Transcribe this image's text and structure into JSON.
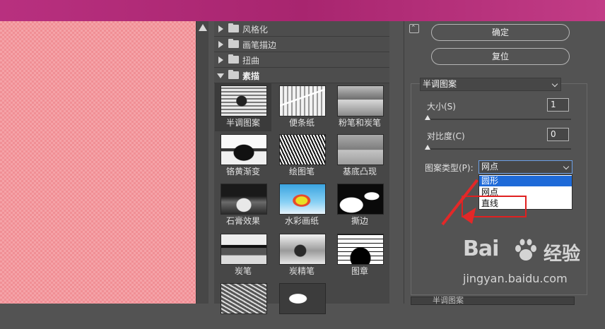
{
  "gallery": {
    "categories": [
      {
        "label": "风格化",
        "open": false
      },
      {
        "label": "画笔描边",
        "open": false
      },
      {
        "label": "扭曲",
        "open": false
      },
      {
        "label": "素描",
        "open": true
      }
    ],
    "thumbs": [
      {
        "label": "半调图案",
        "selected": true
      },
      {
        "label": "便条纸"
      },
      {
        "label": "粉笔和炭笔"
      },
      {
        "label": "铬黄渐变"
      },
      {
        "label": "绘图笔"
      },
      {
        "label": "基底凸现"
      },
      {
        "label": "石膏效果"
      },
      {
        "label": "水彩画纸"
      },
      {
        "label": "撕边"
      },
      {
        "label": "炭笔"
      },
      {
        "label": "炭精笔"
      },
      {
        "label": "图章"
      }
    ]
  },
  "dialog": {
    "collapse_icon": "collapse-icon",
    "ok_label": "确定",
    "reset_label": "复位",
    "filter_select": "半调图案",
    "size_label": "大小(S)",
    "size_value": "1",
    "contrast_label": "对比度(C)",
    "contrast_value": "0",
    "pattern_type_label": "图案类型(P):",
    "pattern_type_value": "网点",
    "pattern_options": [
      "圆形",
      "网点",
      "直线"
    ],
    "highlighted_option": "圆形",
    "bottom_layer_label": "半调图案"
  },
  "watermark": {
    "logo_text": "Bai",
    "logo_suffix": "经验",
    "url": "jingyan.baidu.com"
  },
  "colors": {
    "accent_highlight": "#1e6ad8",
    "annotation_red": "#e32828",
    "title_bar": "#b8307f"
  }
}
